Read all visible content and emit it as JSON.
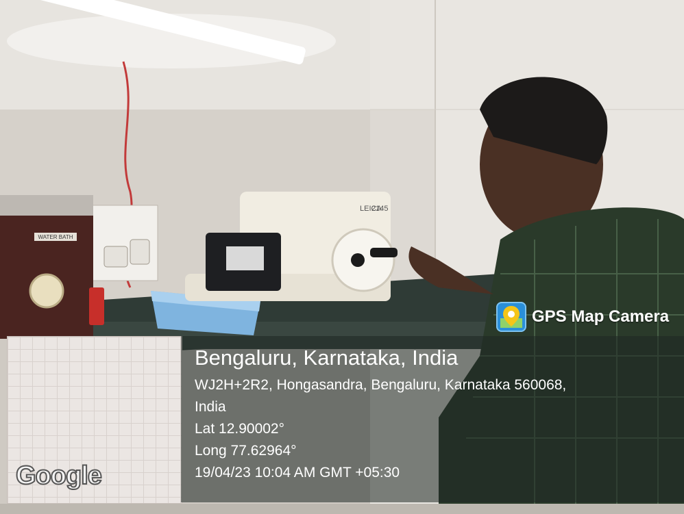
{
  "app_badge": {
    "title": "GPS Map Camera",
    "icon": "map-pin-icon",
    "icon_color": "#2a8fd9"
  },
  "map": {
    "provider_logo": "Google"
  },
  "location": {
    "title": "Bengaluru, Karnataka, India",
    "address_line1": "WJ2H+2R2, Hongasandra, Bengaluru, Karnataka 560068,",
    "address_line2": "India",
    "latitude": "Lat 12.90002°",
    "longitude": "Long 77.62964°",
    "datetime": "19/04/23 10:04 AM GMT +05:30"
  },
  "scene_labels": {
    "water_bath": "WATER BATH",
    "microtome_brand": "LEICA",
    "microtome_model": "2145"
  }
}
